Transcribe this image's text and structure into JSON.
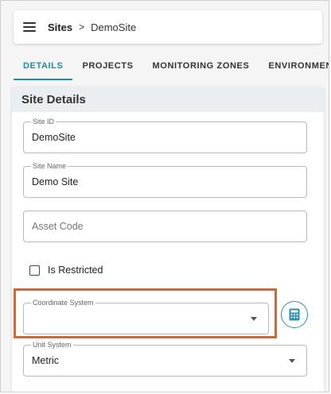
{
  "breadcrumb": {
    "root": "Sites",
    "separator": ">",
    "current": "DemoSite"
  },
  "tabs": [
    {
      "label": "DETAILS",
      "active": true
    },
    {
      "label": "PROJECTS",
      "active": false
    },
    {
      "label": "MONITORING ZONES",
      "active": false
    },
    {
      "label": "ENVIRONMENTAL",
      "active": false
    }
  ],
  "card": {
    "title": "Site Details"
  },
  "fields": {
    "site_id": {
      "label": "Site ID",
      "value": "DemoSite"
    },
    "site_name": {
      "label": "Site Name",
      "value": "Demo Site"
    },
    "asset_code": {
      "placeholder": "Asset Code",
      "value": ""
    },
    "is_restricted": {
      "label": "Is Restricted",
      "checked": false
    },
    "coordinate_system": {
      "label": "Coordinate System",
      "value": ""
    },
    "unit_system": {
      "label": "Unit System",
      "value": "Metric"
    }
  },
  "colors": {
    "accent": "#1a8fa8",
    "highlight": "#e8601c",
    "header_bg": "#e9eef2"
  },
  "icons": {
    "menu": "hamburger-menu-icon",
    "dropdown": "chevron-down-icon",
    "calculator": "calculator-icon"
  }
}
